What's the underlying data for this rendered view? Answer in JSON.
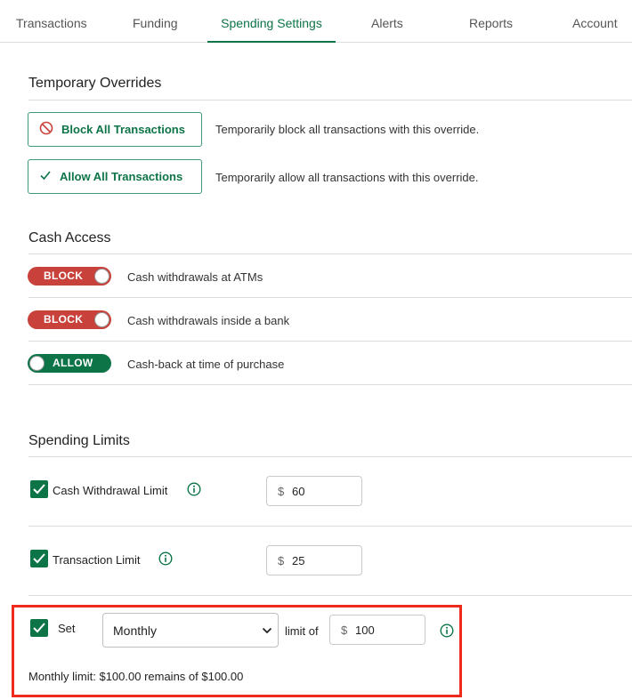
{
  "tabs": [
    {
      "label": "Transactions",
      "active": false
    },
    {
      "label": "Funding",
      "active": false
    },
    {
      "label": "Spending Settings",
      "active": true
    },
    {
      "label": "Alerts",
      "active": false
    },
    {
      "label": "Reports",
      "active": false
    },
    {
      "label": "Account",
      "active": false
    }
  ],
  "overrides": {
    "title": "Temporary Overrides",
    "block_label": "Block All Transactions",
    "block_desc": "Temporarily block all transactions with this override.",
    "allow_label": "Allow All Transactions",
    "allow_desc": "Temporarily allow all transactions with this override."
  },
  "cash_access": {
    "title": "Cash Access",
    "items": [
      {
        "state": "BLOCK",
        "desc": "Cash withdrawals at ATMs"
      },
      {
        "state": "BLOCK",
        "desc": "Cash withdrawals inside a bank"
      },
      {
        "state": "ALLOW",
        "desc": "Cash-back at time of purchase"
      }
    ]
  },
  "spending_limits": {
    "title": "Spending Limits",
    "cash_withdrawal": {
      "label": "Cash Withdrawal Limit",
      "checked": true,
      "currency": "$",
      "value": "60"
    },
    "transaction": {
      "label": "Transaction Limit",
      "checked": true,
      "currency": "$",
      "value": "25"
    },
    "period": {
      "checked": true,
      "set_label": "Set",
      "period_value": "Monthly",
      "limit_of_label": "limit of",
      "currency": "$",
      "value": "100",
      "summary": "Monthly limit: $100.00 remains of $100.00"
    }
  },
  "colors": {
    "brand_green": "#0d7448",
    "block_red": "#c8423b",
    "highlight_red": "#ee2a1b"
  }
}
